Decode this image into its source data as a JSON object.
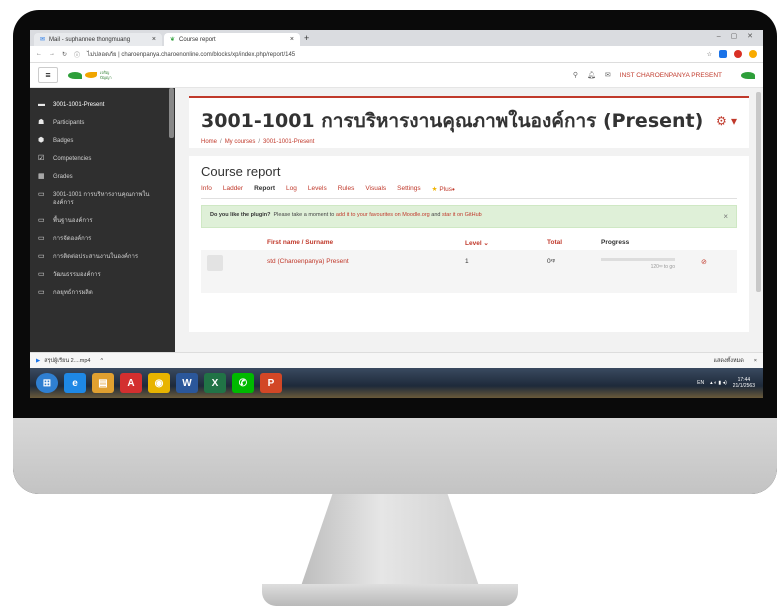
{
  "browser": {
    "tabs": [
      {
        "label": "Mail - suphannee thongmuang",
        "close": "×"
      },
      {
        "label": "Course report",
        "close": "×"
      }
    ],
    "new_tab": "+",
    "url": "ไม่ปลอดภัย | charoenpanya.charoenonline.com/blocks/xp/index.php/report/145",
    "window_controls": "– ▢ ✕"
  },
  "navbar": {
    "hamburger": "≡",
    "user": "INST CHAROENPANYA PRESENT"
  },
  "sidebar": {
    "items": [
      {
        "icon": "▬",
        "label": "3001-1001-Present"
      },
      {
        "icon": "☗",
        "label": "Participants"
      },
      {
        "icon": "⬢",
        "label": "Badges"
      },
      {
        "icon": "☑",
        "label": "Competencies"
      },
      {
        "icon": "▦",
        "label": "Grades"
      },
      {
        "icon": "▭",
        "label": "3001-1001 การบริหารงานคุณภาพในองค์การ"
      },
      {
        "icon": "▭",
        "label": "พื้นฐานองค์การ"
      },
      {
        "icon": "▭",
        "label": "การจัดองค์การ"
      },
      {
        "icon": "▭",
        "label": "การติดต่อประสานงานในองค์การ"
      },
      {
        "icon": "▭",
        "label": "วัฒนธรรมองค์การ"
      },
      {
        "icon": "▭",
        "label": "กลยุทธ์การผลิต"
      }
    ]
  },
  "header": {
    "title": "3001-1001 การบริหารงานคุณภาพในองค์การ (Present)",
    "cog": "⚙ ▾",
    "breadcrumb": [
      "Home",
      "My courses",
      "3001-1001-Present"
    ]
  },
  "report": {
    "title": "Course report",
    "tabs": [
      "Info",
      "Ladder",
      "Report",
      "Log",
      "Levels",
      "Rules",
      "Visuals",
      "Settings"
    ],
    "plus_tab": "Plus",
    "alert": {
      "question": "Do you like the plugin?",
      "text": "Please take a moment to",
      "link1": "add it to your favourites on Moodle.org",
      "and": "and",
      "link2": "star it on GitHub",
      "close": "×"
    },
    "columns": {
      "name": "First name / Surname",
      "level": "Level ⌄",
      "total": "Total",
      "progress": "Progress"
    },
    "rows": [
      {
        "name": "std (Charoenpanya) Present",
        "level": "1",
        "total": "0ˣᵖ",
        "progress_fraction": 0,
        "progress_text": "120ˣᵖ to go",
        "delete": "⊘"
      }
    ]
  },
  "download": {
    "file": "สรุปผู้เรียน 2....mp4",
    "caret": "^",
    "show_all": "แสดงทั้งหมด",
    "close": "×"
  },
  "taskbar": {
    "icons": [
      {
        "name": "start",
        "label": "⊞",
        "color": "#2f7fd1"
      },
      {
        "name": "ie",
        "label": "e",
        "color": "#1e88e5"
      },
      {
        "name": "explorer",
        "label": "▤",
        "color": "#e0a030"
      },
      {
        "name": "pdf",
        "label": "A",
        "color": "#d32f2f"
      },
      {
        "name": "chrome",
        "label": "◉",
        "color": "#e8b400"
      },
      {
        "name": "word",
        "label": "W",
        "color": "#2b579a"
      },
      {
        "name": "excel",
        "label": "X",
        "color": "#217346"
      },
      {
        "name": "line",
        "label": "✆",
        "color": "#00b900"
      },
      {
        "name": "powerpoint",
        "label": "P",
        "color": "#d24726"
      }
    ],
    "lang": "EN",
    "time": "17:44",
    "date": "21/1/2563"
  }
}
